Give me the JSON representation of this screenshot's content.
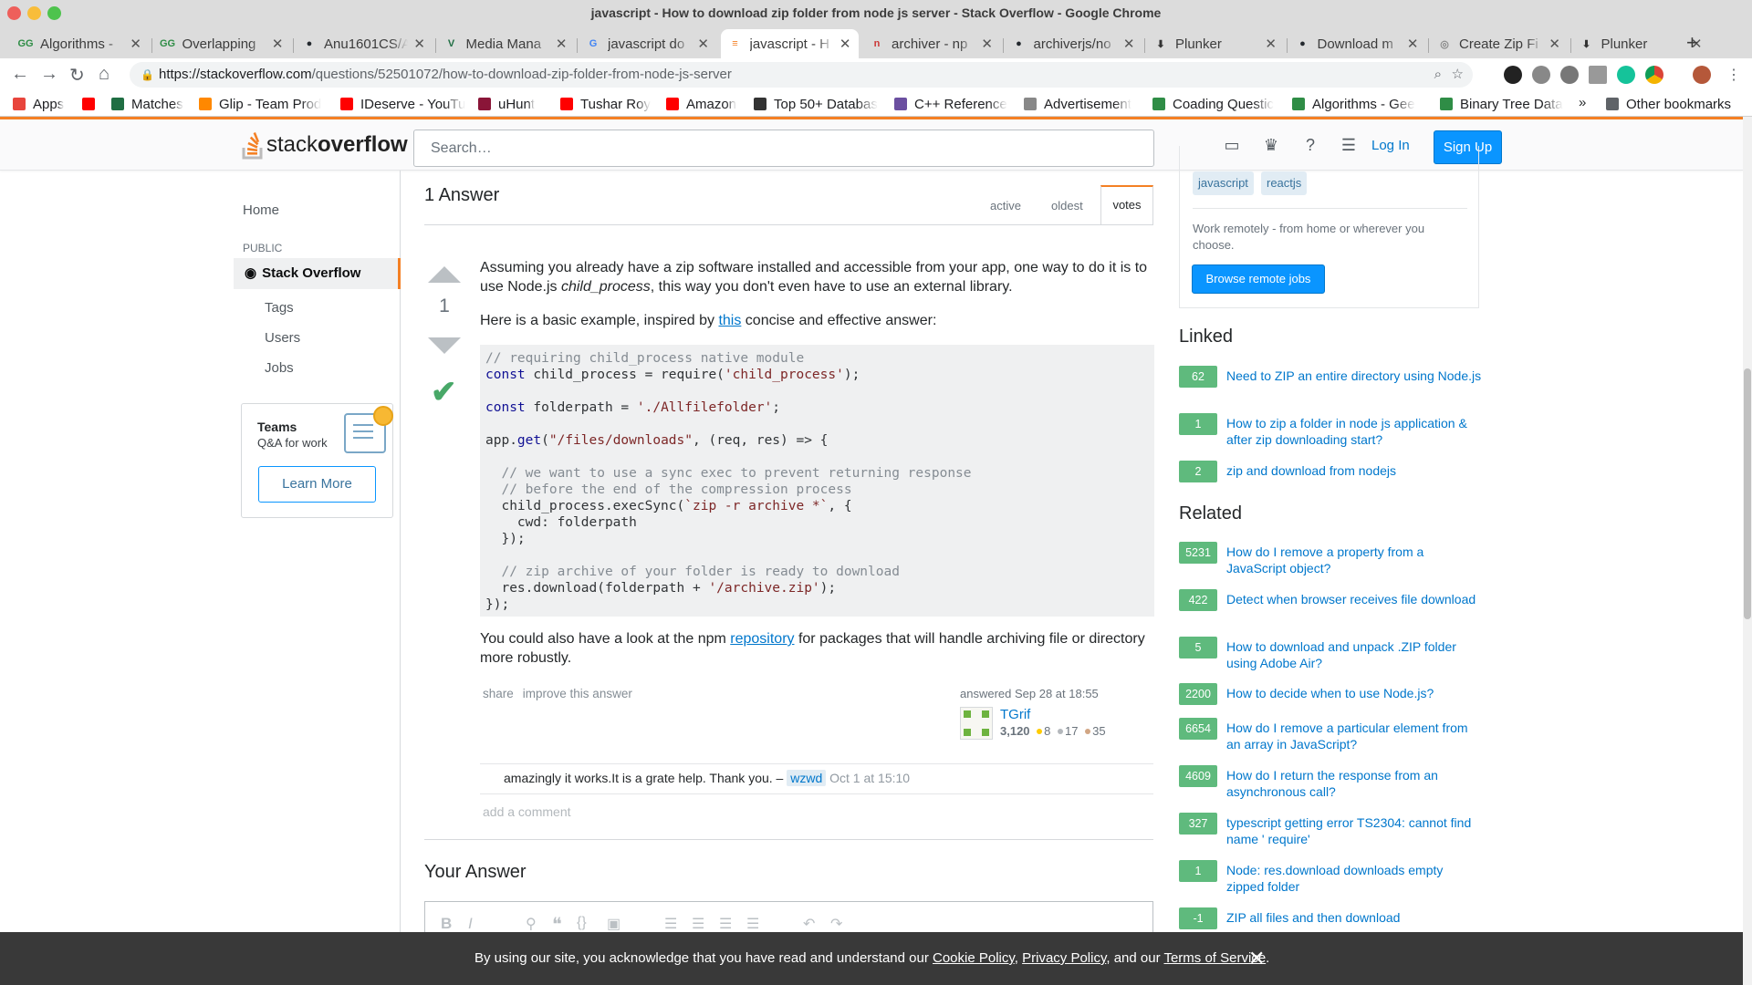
{
  "browser": {
    "title": "javascript - How to download zip folder from node js server - Stack Overflow - Google Chrome",
    "tabs": [
      {
        "label": "Algorithms -",
        "favicon": "GG"
      },
      {
        "label": "Overlapping",
        "favicon": "GG"
      },
      {
        "label": "Anu1601CS/A",
        "favicon": "github"
      },
      {
        "label": "Media Mana",
        "favicon": "V"
      },
      {
        "label": "javascript do",
        "favicon": "G"
      },
      {
        "label": "javascript - H",
        "favicon": "so"
      },
      {
        "label": "archiver - np",
        "favicon": "npm"
      },
      {
        "label": "archiverjs/no",
        "favicon": "github"
      },
      {
        "label": "Plunker",
        "favicon": "plunker"
      },
      {
        "label": "Download m",
        "favicon": "github"
      },
      {
        "label": "Create Zip Fi",
        "favicon": "chrome"
      },
      {
        "label": "Plunker",
        "favicon": "plunker"
      }
    ],
    "new_tab": "+",
    "url_host": "https://stackoverflow.com",
    "url_path": "/questions/52501072/how-to-download-zip-folder-from-node-js-server",
    "bookmarks": [
      {
        "label": "Apps",
        "color": "#e8453c"
      },
      {
        "label": "",
        "color": "#ff0000"
      },
      {
        "label": "Matches",
        "color": "#1f6e43"
      },
      {
        "label": "Glip - Team Prod",
        "color": "#ff8800"
      },
      {
        "label": "IDeserve - YouTu",
        "color": "#ff0000"
      },
      {
        "label": "uHunt",
        "color": "#8a1538"
      },
      {
        "label": "Tushar Roy",
        "color": "#ff0000"
      },
      {
        "label": "Amazon",
        "color": "#ff0000"
      },
      {
        "label": "Top 50+ Databas",
        "color": "#333333"
      },
      {
        "label": "C++ Reference",
        "color": "#6b4fa0"
      },
      {
        "label": "Advertisement",
        "color": "#888888"
      },
      {
        "label": "Coading Questic",
        "color": "#2f8d46"
      },
      {
        "label": "Algorithms - Gee",
        "color": "#2f8d46"
      },
      {
        "label": "Binary Tree Data",
        "color": "#2f8d46"
      }
    ],
    "more_bookmarks": "»",
    "other_bookmarks": "Other bookmarks"
  },
  "so_header": {
    "logo_light": "stack",
    "logo_bold": "overflow",
    "search_placeholder": "Search…",
    "login": "Log In",
    "signup": "Sign Up"
  },
  "leftnav": {
    "home": "Home",
    "public": "PUBLIC",
    "stackoverflow": "Stack Overflow",
    "tags": "Tags",
    "users": "Users",
    "jobs": "Jobs",
    "teams_title": "Teams",
    "teams_sub": "Q&A for work",
    "learn_more": "Learn More"
  },
  "answers": {
    "heading": "1 Answer",
    "sort": {
      "active": "active",
      "oldest": "oldest",
      "votes": "votes"
    },
    "votes": "1",
    "para1_a": "Assuming you already have a zip software installed and accessible from your app, one way to do it is to use Node.js ",
    "para1_em": "child_process",
    "para1_b": ", this way you don't even have to use an external library.",
    "para2_a": "Here is a basic example, inspired by ",
    "para2_link": "this",
    "para2_b": " concise and effective answer:",
    "para3_a": "You could also have a look at the npm ",
    "para3_link": "repository",
    "para3_b": " for packages that will handle archiving file or directory more robustly.",
    "share": "share",
    "improve": "improve this answer",
    "answered": "answered Sep 28 at 18:55",
    "user": "TGrif",
    "rep": "3,120",
    "gold": "8",
    "silver": "17",
    "bronze": "35",
    "comment_text": "amazingly it works.It is a grate help. Thank you. –",
    "comment_user": "wzwd",
    "comment_date": "Oct 1 at 15:10",
    "add_comment": "add a comment",
    "your_answer": "Your Answer"
  },
  "code": {
    "l1": "// requiring child_process native module",
    "l2_kw": "const",
    "l2_a": " child_process = require(",
    "l2_str": "'child_process'",
    "l2_b": ");",
    "l4_kw": "const",
    "l4_a": " folderpath = ",
    "l4_str": "'./Allfilefolder'",
    "l4_b": ";",
    "l6_a": "app.",
    "l6_kw": "get",
    "l6_b": "(",
    "l6_str": "\"/files/downloads\"",
    "l6_c": ", (req, res) => {",
    "l8": "  // we want to use a sync exec to prevent returning response",
    "l9": "  // before the end of the compression process",
    "l10_a": "  child_process.execSync(",
    "l10_str": "`zip -r archive *`",
    "l10_b": ", {",
    "l11": "    cwd: folderpath",
    "l12": "  });",
    "l14": "  // zip archive of your folder is ready to download",
    "l15_a": "  res.download(folderpath + ",
    "l15_str": "'/archive.zip'",
    "l15_b": ");",
    "l16": "});"
  },
  "sidebar": {
    "tags": [
      "javascript",
      "reactjs"
    ],
    "jobs_text": "Work remotely - from home or wherever you choose.",
    "browse_jobs": "Browse remote jobs",
    "linked_heading": "Linked",
    "linked": [
      {
        "score": "62",
        "title": "Need to ZIP an entire directory using Node.js"
      },
      {
        "score": "1",
        "title": "How to zip a folder in node js application & after zip downloading start?"
      },
      {
        "score": "2",
        "title": "zip and download from nodejs"
      }
    ],
    "related_heading": "Related",
    "related": [
      {
        "score": "5231",
        "title": "How do I remove a property from a JavaScript object?"
      },
      {
        "score": "422",
        "title": "Detect when browser receives file download"
      },
      {
        "score": "5",
        "title": "How to download and unpack .ZIP folder using Adobe Air?"
      },
      {
        "score": "2200",
        "title": "How to decide when to use Node.js?"
      },
      {
        "score": "6654",
        "title": "How do I remove a particular element from an array in JavaScript?"
      },
      {
        "score": "4609",
        "title": "How do I return the response from an asynchronous call?"
      },
      {
        "score": "327",
        "title": "typescript getting error TS2304: cannot find name ' require'"
      },
      {
        "score": "1",
        "title": "Node: res.download downloads empty zipped folder"
      },
      {
        "score": "-1",
        "title": "ZIP all files and then download"
      }
    ]
  },
  "cookie": {
    "text_a": "By using our site, you acknowledge that you have read and understand our ",
    "cookie_policy": "Cookie Policy",
    "sep1": ", ",
    "privacy_policy": "Privacy Policy",
    "sep2": ", and our ",
    "terms": "Terms of Service",
    "end": ".",
    "close": "✕"
  },
  "colors": {
    "so_orange": "#f48024",
    "so_blue": "#0a95ff",
    "accepted_green": "#5fba7d",
    "link_blue": "#0077cc"
  }
}
